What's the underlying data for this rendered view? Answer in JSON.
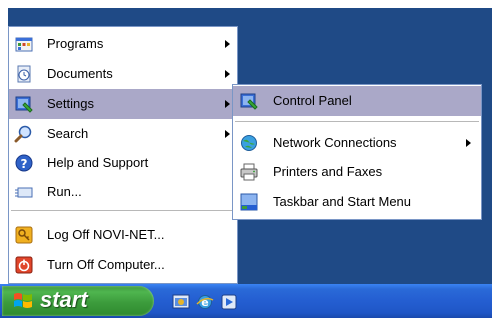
{
  "start_menu": {
    "items": [
      {
        "label": "Programs",
        "icon": "programs-icon",
        "has_submenu": true
      },
      {
        "label": "Documents",
        "icon": "documents-icon",
        "has_submenu": true
      },
      {
        "label": "Settings",
        "icon": "settings-icon",
        "has_submenu": true,
        "selected": true
      },
      {
        "label": "Search",
        "icon": "search-icon",
        "has_submenu": true
      },
      {
        "label": "Help and Support",
        "icon": "help-icon",
        "has_submenu": false
      },
      {
        "label": "Run...",
        "icon": "run-icon",
        "has_submenu": false
      },
      {
        "label": "Log Off NOVI-NET...",
        "icon": "log-off-icon",
        "has_submenu": false
      },
      {
        "label": "Turn Off Computer...",
        "icon": "turn-off-icon",
        "has_submenu": false
      }
    ]
  },
  "settings_submenu": {
    "items": [
      {
        "label": "Control Panel",
        "icon": "control-panel-icon",
        "has_submenu": false,
        "selected": true
      },
      {
        "label": "Network Connections",
        "icon": "network-connections-icon",
        "has_submenu": true
      },
      {
        "label": "Printers and Faxes",
        "icon": "printers-icon",
        "has_submenu": false
      },
      {
        "label": "Taskbar and Start Menu",
        "icon": "taskbar-icon",
        "has_submenu": false
      }
    ]
  },
  "taskbar": {
    "start_label": "start",
    "quick_launch": [
      "show-desktop-icon",
      "internet-explorer-icon",
      "media-player-icon"
    ]
  },
  "colors": {
    "desktop": "#1f4a86",
    "selection": "#aaa8c8",
    "taskbar": "#245ed1",
    "start_button": "#3c9c3c"
  }
}
